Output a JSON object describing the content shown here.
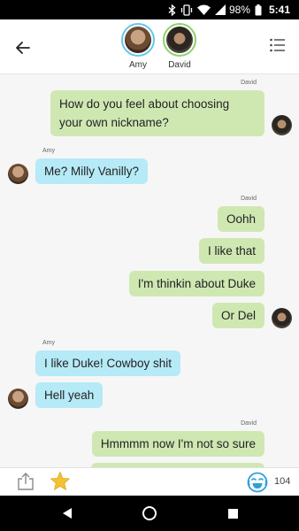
{
  "status_bar": {
    "battery": "98%",
    "time": "5:41",
    "icons": [
      "bluetooth-icon",
      "vibrate-icon",
      "wifi-icon",
      "signal-icon",
      "battery-icon"
    ]
  },
  "header": {
    "participants": [
      {
        "name": "Amy",
        "ring_color": "#62c8e8"
      },
      {
        "name": "David",
        "ring_color": "#8cd36b"
      }
    ]
  },
  "messages": [
    {
      "sender": "David",
      "show_sender": true,
      "direction": "out",
      "lines": [
        "How do you feel about choosing",
        "your own nickname?"
      ],
      "avatar": true
    },
    {
      "sender": "Amy",
      "show_sender": true,
      "direction": "in",
      "lines": [
        "Me? Milly Vanilly?"
      ],
      "avatar": true
    },
    {
      "sender": "David",
      "show_sender": true,
      "direction": "out",
      "lines": [
        "Oohh"
      ],
      "avatar": false
    },
    {
      "sender": "David",
      "show_sender": false,
      "direction": "out",
      "lines": [
        "I like that"
      ],
      "avatar": false
    },
    {
      "sender": "David",
      "show_sender": false,
      "direction": "out",
      "lines": [
        "I'm thinkin about Duke"
      ],
      "avatar": false
    },
    {
      "sender": "David",
      "show_sender": false,
      "direction": "out",
      "lines": [
        "Or Del"
      ],
      "avatar": true
    },
    {
      "sender": "Amy",
      "show_sender": true,
      "direction": "in",
      "lines": [
        "I like Duke! Cowboy shit"
      ],
      "avatar": false
    },
    {
      "sender": "Amy",
      "show_sender": false,
      "direction": "in",
      "lines": [
        "Hell yeah"
      ],
      "avatar": true
    },
    {
      "sender": "David",
      "show_sender": true,
      "direction": "out",
      "lines": [
        "Hmmmm now I'm not so sure"
      ],
      "avatar": false
    }
  ],
  "actions": {
    "laugh_count": "104"
  },
  "colors": {
    "outgoing_bubble": "#cfe8b2",
    "incoming_bubble": "#b6eaf7",
    "amy_accent": "#62c8e8",
    "david_accent": "#8cd36b",
    "star": "#f3c234"
  }
}
